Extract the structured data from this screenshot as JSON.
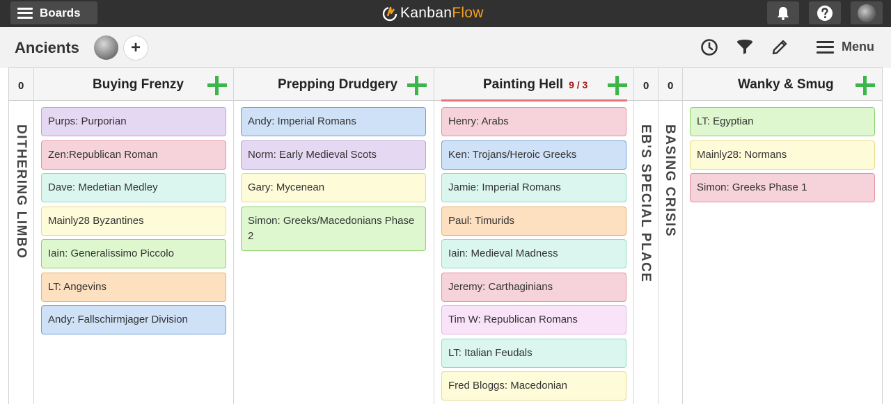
{
  "topbar": {
    "boards_label": "Boards",
    "logo_kanban": "Kanban",
    "logo_flow": "Flow"
  },
  "subheader": {
    "board_title": "Ancients",
    "add_member": "+",
    "menu_label": "Menu"
  },
  "columns": [
    {
      "title": "",
      "count": "0",
      "collapsed_label": "DITHERING LIMBO"
    },
    {
      "title": "Buying Frenzy",
      "cards": [
        {
          "text": "Purps: Purporian",
          "color": "purple"
        },
        {
          "text": "Zen:Republican Roman",
          "color": "pink"
        },
        {
          "text": "Dave: Medetian Medley",
          "color": "mint"
        },
        {
          "text": "Mainly28 Byzantines",
          "color": "yellow"
        },
        {
          "text": "Iain: Generalissimo Piccolo",
          "color": "green"
        },
        {
          "text": "LT: Angevins",
          "color": "orange"
        },
        {
          "text": "Andy: Fallschirmjager Division",
          "color": "blue"
        }
      ]
    },
    {
      "title": "Prepping Drudgery",
      "cards": [
        {
          "text": "Andy: Imperial Romans",
          "color": "blue"
        },
        {
          "text": "Norm: Early Medieval Scots",
          "color": "purple"
        },
        {
          "text": "Gary: Mycenean",
          "color": "yellow"
        },
        {
          "text": "Simon: Greeks/Macedonians Phase 2",
          "color": "green"
        }
      ]
    },
    {
      "title": "Painting Hell",
      "wip": "9 / 3",
      "cards": [
        {
          "text": "Henry: Arabs",
          "color": "pink"
        },
        {
          "text": "Ken: Trojans/Heroic Greeks",
          "color": "blue"
        },
        {
          "text": "Jamie: Imperial Romans",
          "color": "mint"
        },
        {
          "text": "Paul: Timurids",
          "color": "orange"
        },
        {
          "text": "Iain: Medieval Madness",
          "color": "mint"
        },
        {
          "text": "Jeremy: Carthaginians",
          "color": "pink"
        },
        {
          "text": "Tim W: Republican Romans",
          "color": "lavender"
        },
        {
          "text": "LT: Italian Feudals",
          "color": "mint"
        },
        {
          "text": "Fred Bloggs: Macedonian",
          "color": "yellow"
        }
      ]
    },
    {
      "title": "",
      "count": "0",
      "collapsed_label": "EB'S SPECIAL PLACE"
    },
    {
      "title": "",
      "count": "0",
      "collapsed_label": "BASING CRISIS"
    },
    {
      "title": "Wanky & Smug",
      "cards": [
        {
          "text": "LT: Egyptian",
          "color": "green"
        },
        {
          "text": "Mainly28: Normans",
          "color": "yellow"
        },
        {
          "text": "Simon: Greeks Phase 1",
          "color": "pink"
        }
      ]
    }
  ]
}
